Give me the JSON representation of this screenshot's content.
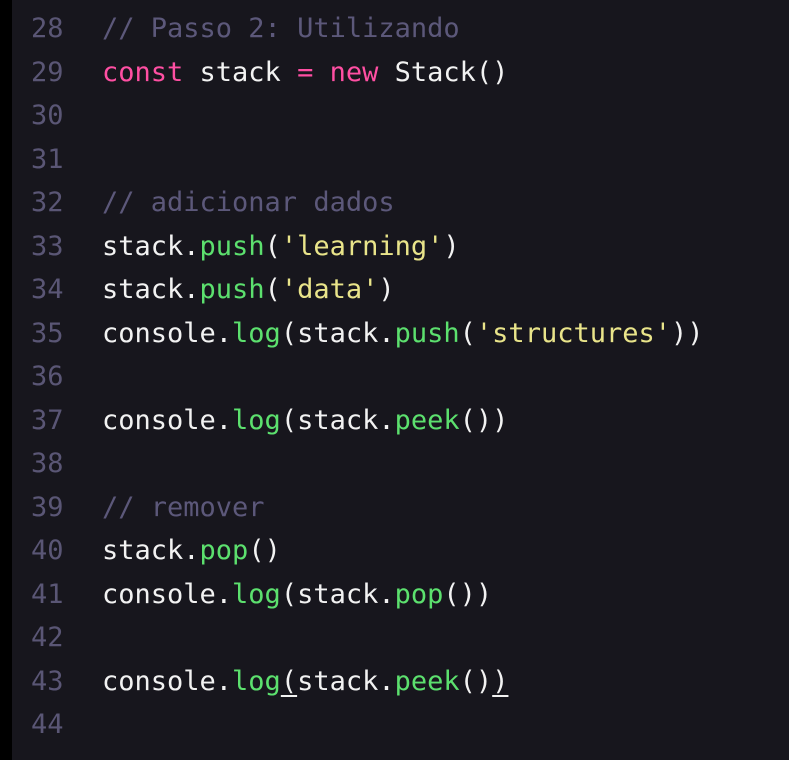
{
  "colors": {
    "background": "#17161d",
    "gutter": "#5a5675",
    "comment": "#5c587a",
    "keyword": "#ff4fa3",
    "plain": "#f2f2f2",
    "method": "#5ce06e",
    "string": "#e9e48a"
  },
  "lines": [
    {
      "number": "28",
      "tokens": [
        {
          "text": "// Passo 2: Utilizando",
          "kind": "comment"
        }
      ]
    },
    {
      "number": "29",
      "tokens": [
        {
          "text": "const",
          "kind": "keyword"
        },
        {
          "text": " stack ",
          "kind": "plain"
        },
        {
          "text": "=",
          "kind": "keyword"
        },
        {
          "text": " ",
          "kind": "plain"
        },
        {
          "text": "new",
          "kind": "keyword"
        },
        {
          "text": " Stack()",
          "kind": "plain"
        }
      ]
    },
    {
      "number": "30",
      "tokens": []
    },
    {
      "number": "31",
      "tokens": []
    },
    {
      "number": "32",
      "tokens": [
        {
          "text": "// adicionar dados",
          "kind": "comment"
        }
      ]
    },
    {
      "number": "33",
      "tokens": [
        {
          "text": "stack.",
          "kind": "plain"
        },
        {
          "text": "push",
          "kind": "method"
        },
        {
          "text": "(",
          "kind": "punct"
        },
        {
          "text": "'learning'",
          "kind": "string"
        },
        {
          "text": ")",
          "kind": "punct"
        }
      ]
    },
    {
      "number": "34",
      "tokens": [
        {
          "text": "stack.",
          "kind": "plain"
        },
        {
          "text": "push",
          "kind": "method"
        },
        {
          "text": "(",
          "kind": "punct"
        },
        {
          "text": "'data'",
          "kind": "string"
        },
        {
          "text": ")",
          "kind": "punct"
        }
      ]
    },
    {
      "number": "35",
      "tokens": [
        {
          "text": "console.",
          "kind": "plain"
        },
        {
          "text": "log",
          "kind": "method"
        },
        {
          "text": "(stack.",
          "kind": "plain"
        },
        {
          "text": "push",
          "kind": "method"
        },
        {
          "text": "(",
          "kind": "punct"
        },
        {
          "text": "'structures'",
          "kind": "string"
        },
        {
          "text": "))",
          "kind": "punct"
        }
      ]
    },
    {
      "number": "36",
      "tokens": []
    },
    {
      "number": "37",
      "tokens": [
        {
          "text": "console.",
          "kind": "plain"
        },
        {
          "text": "log",
          "kind": "method"
        },
        {
          "text": "(stack.",
          "kind": "plain"
        },
        {
          "text": "peek",
          "kind": "method"
        },
        {
          "text": "())",
          "kind": "punct"
        }
      ]
    },
    {
      "number": "38",
      "tokens": []
    },
    {
      "number": "39",
      "tokens": [
        {
          "text": "// remover",
          "kind": "comment"
        }
      ]
    },
    {
      "number": "40",
      "tokens": [
        {
          "text": "stack.",
          "kind": "plain"
        },
        {
          "text": "pop",
          "kind": "method"
        },
        {
          "text": "()",
          "kind": "punct"
        }
      ]
    },
    {
      "number": "41",
      "tokens": [
        {
          "text": "console.",
          "kind": "plain"
        },
        {
          "text": "log",
          "kind": "method"
        },
        {
          "text": "(stack.",
          "kind": "plain"
        },
        {
          "text": "pop",
          "kind": "method"
        },
        {
          "text": "())",
          "kind": "punct"
        }
      ]
    },
    {
      "number": "42",
      "tokens": []
    },
    {
      "number": "43",
      "tokens": [
        {
          "text": "console.",
          "kind": "plain"
        },
        {
          "text": "log",
          "kind": "method"
        },
        {
          "text": "(",
          "kind": "punct",
          "underline": true
        },
        {
          "text": "stack.",
          "kind": "plain"
        },
        {
          "text": "peek",
          "kind": "method"
        },
        {
          "text": "()",
          "kind": "punct"
        },
        {
          "text": ")",
          "kind": "punct",
          "underline": true
        }
      ]
    },
    {
      "number": "44",
      "tokens": []
    }
  ]
}
